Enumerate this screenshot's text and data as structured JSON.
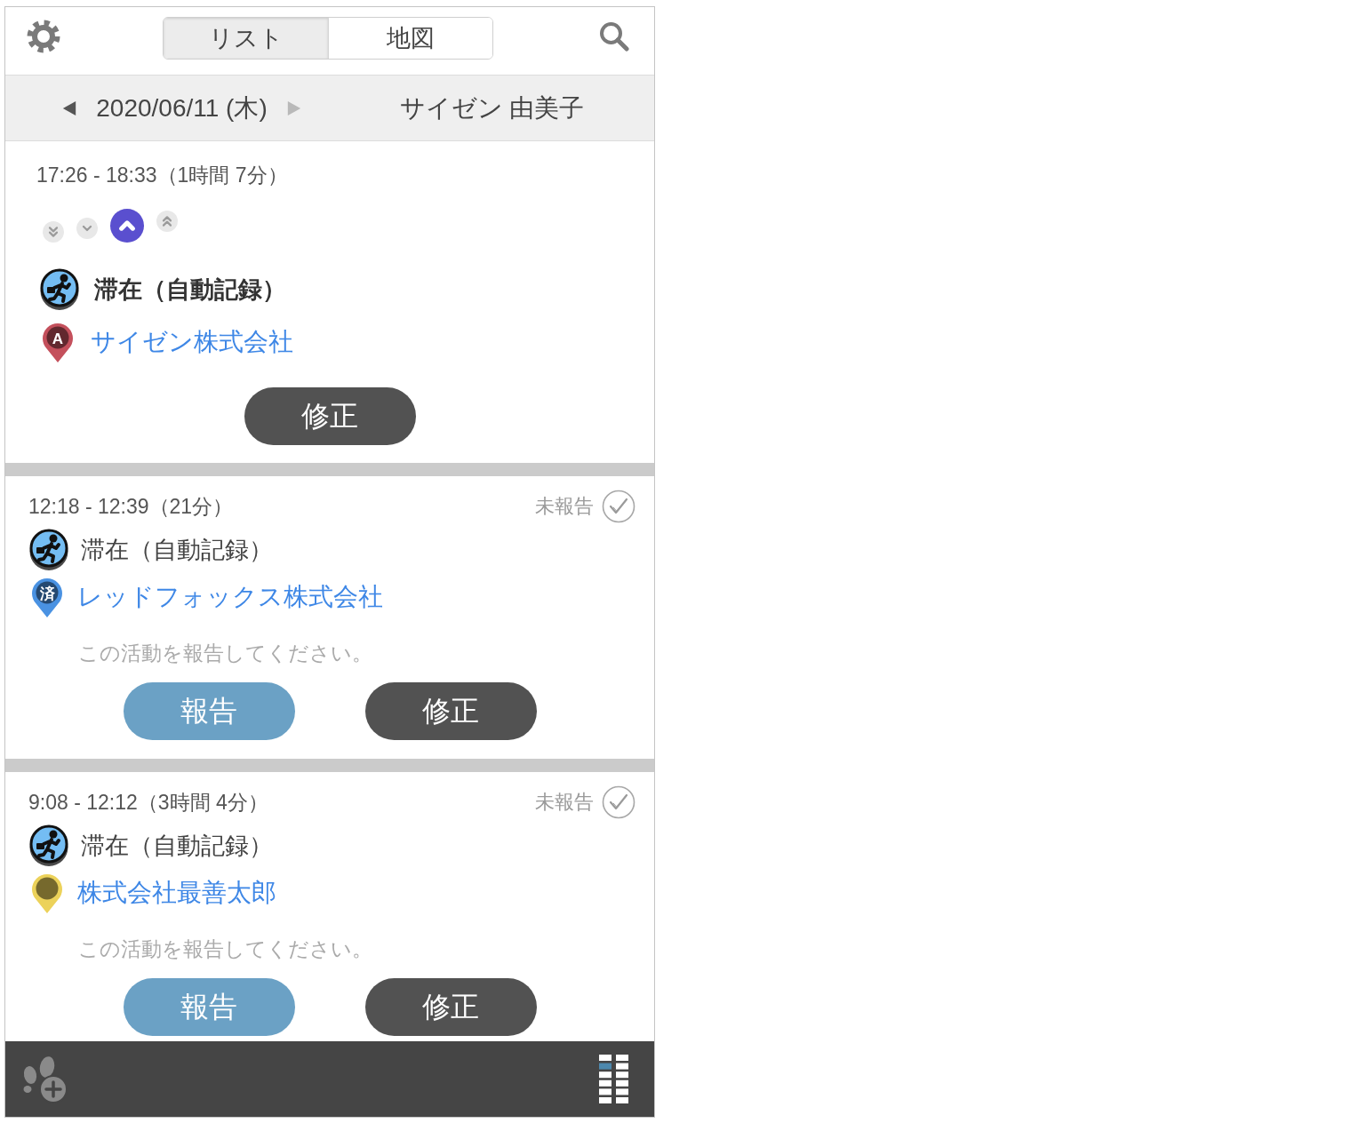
{
  "header": {
    "tabs": [
      {
        "label": "リスト",
        "selected": true
      },
      {
        "label": "地図",
        "selected": false
      }
    ]
  },
  "date_bar": {
    "prev": {
      "disabled": false
    },
    "date": "2020/06/11 (木)",
    "next": {
      "disabled": true
    },
    "user": "サイゼン 由美子"
  },
  "cards": [
    {
      "kind": "current",
      "time": "17:26 - 18:33（1時間 7分）",
      "levels": [
        {
          "kind": "double-down",
          "selected": false
        },
        {
          "kind": "down",
          "selected": false
        },
        {
          "kind": "up",
          "selected": true
        },
        {
          "kind": "double-up",
          "selected": false
        }
      ],
      "activity": "滞在（自動記録）",
      "place": {
        "name": "サイゼン株式会社",
        "marker": {
          "color": "#c4505c",
          "label": "A"
        }
      },
      "buttons": [
        {
          "kind": "edit",
          "label": "修正"
        }
      ]
    },
    {
      "kind": "past",
      "time": "12:18 - 12:39（21分）",
      "status": {
        "label": "未報告",
        "checked": false
      },
      "activity": "滞在（自動記録）",
      "place": {
        "name": "レッドフォックス株式会社",
        "marker": {
          "color": "#4a92e2",
          "label": "済"
        }
      },
      "message": "この活動を報告してください。",
      "buttons": [
        {
          "kind": "report",
          "label": "報告"
        },
        {
          "kind": "edit",
          "label": "修正"
        }
      ]
    },
    {
      "kind": "past",
      "time": "9:08 - 12:12（3時間 4分）",
      "status": {
        "label": "未報告",
        "checked": false
      },
      "activity": "滞在（自動記録）",
      "place": {
        "name": "株式会社最善太郎",
        "marker": {
          "color": "#ecd25a"
        }
      },
      "message": "この活動を報告してください。",
      "buttons": [
        {
          "kind": "report",
          "label": "報告"
        },
        {
          "kind": "edit",
          "label": "修正"
        }
      ]
    }
  ]
}
